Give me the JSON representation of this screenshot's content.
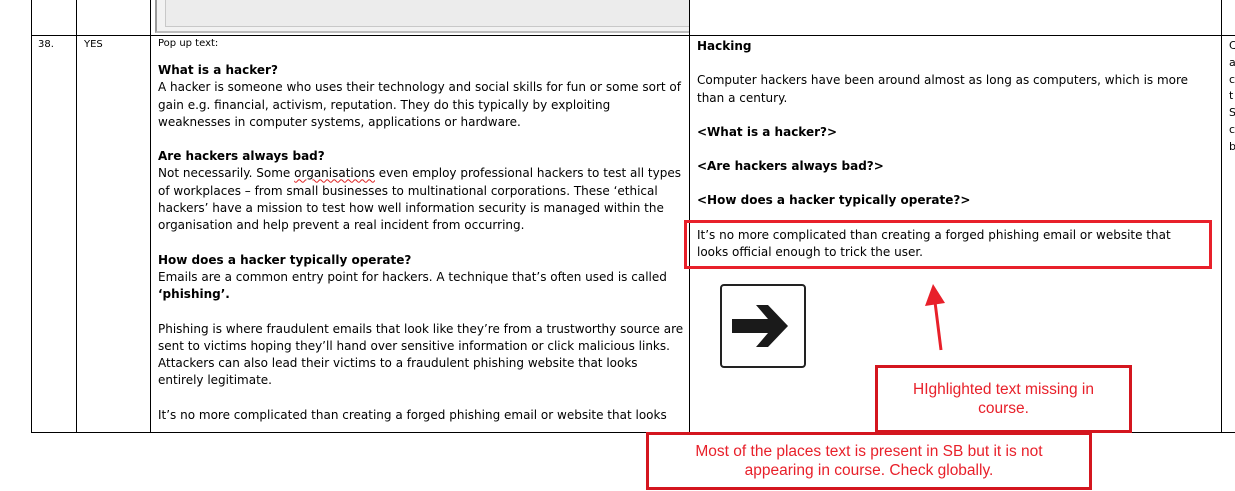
{
  "row": {
    "number": "38.",
    "flag": "YES",
    "popup_label": "Pop up text:",
    "sections": [
      {
        "heading": "What is a hacker?",
        "body": "A hacker is someone who uses their technology and social skills for fun or some sort of gain e.g. financial, activism, reputation. They do this typically by exploiting weaknesses in computer systems, applications or hardware."
      },
      {
        "heading": "Are hackers always bad?",
        "body_before": "Not necessarily. Some ",
        "body_flagged": "organisations",
        "body_after": " even employ professional hackers to test all types of workplaces – from small businesses to multinational corporations. These ‘ethical hackers’ have a mission to test how well information security is managed within the organisation and help prevent a real incident from occurring."
      },
      {
        "heading": "How does a hacker typically operate?",
        "body": "Emails are a common entry point for hackers. A technique that’s often used is called",
        "body_bold": "‘phishing’."
      }
    ],
    "para_phishing": "Phishing is where fraudulent emails that look like they’re from a trustworthy source are sent to victims hoping they’ll hand over sensitive information or click malicious links. Attackers can also lead their victims to a fraudulent phishing website that looks entirely legitimate.",
    "para_last": "It’s no more complicated than creating a forged phishing email or website that looks"
  },
  "course": {
    "title": "Hacking",
    "intro": "Computer hackers have been around almost as long as computers, which is more than a century.",
    "links": [
      "<What is a hacker?>",
      "<Are hackers always bad?>",
      "<How does a hacker typically operate?>"
    ],
    "highlighted": "It’s no more complicated than creating a forged phishing email or website that looks official enough to trick the user.",
    "next_icon": "arrow-right-icon"
  },
  "edge_letters": [
    "C",
    "a",
    "c",
    "t",
    "S",
    "c",
    "b"
  ],
  "annotations": {
    "missing": "HIghlighted text missing in course.",
    "global": "Most of the places text is present in SB but it is not appearing in course. Check globally."
  },
  "colors": {
    "annotation_red": "#e8202a"
  }
}
